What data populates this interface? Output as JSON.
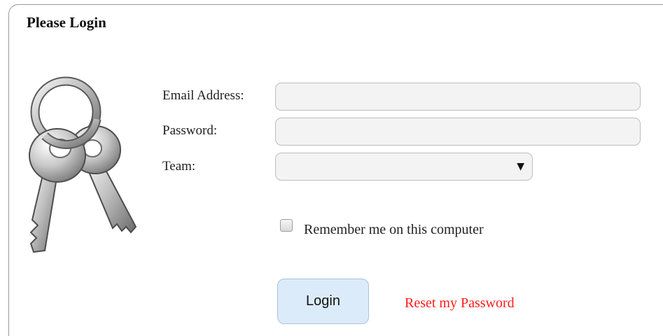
{
  "panel": {
    "title": "Please Login"
  },
  "form": {
    "email_label": "Email Address:",
    "email_value": "",
    "password_label": "Password:",
    "password_value": "",
    "team_label": "Team:",
    "team_selected": "",
    "team_arrow": "▼",
    "remember_label": "Remember me on this computer",
    "remember_checked": false,
    "login_label": "Login",
    "reset_label": "Reset my Password"
  },
  "icons": {
    "keys": "keys-icon",
    "dropdown": "caret-down-icon"
  },
  "colors": {
    "reset_link": "#ff1a1a",
    "login_button_bg": "#dcebfa",
    "input_bg": "#f3f3f3"
  }
}
